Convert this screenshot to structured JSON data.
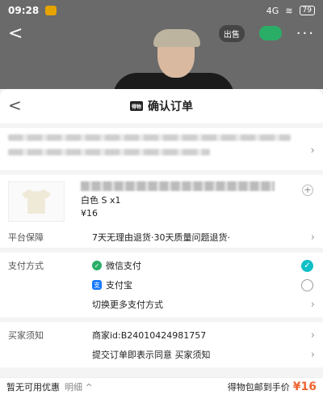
{
  "status_bar": {
    "time": "09:28",
    "signal": "4G",
    "battery": "79"
  },
  "bg_nav": {
    "back": "<",
    "sell_label": "出售",
    "more": "···"
  },
  "sheet": {
    "back": "<",
    "title": "确认订单",
    "title_logo": "得物"
  },
  "product": {
    "variant": "白色 S x1",
    "price": "¥16",
    "plus": "+"
  },
  "guarantee": {
    "label": "平台保障",
    "value": "7天无理由退货·30天质量问题退货·"
  },
  "payment": {
    "label": "支付方式",
    "options": [
      {
        "name": "微信支付",
        "icon": "wechat-pay-icon",
        "selected": true
      },
      {
        "name": "支付宝",
        "icon": "alipay-icon",
        "selected": false
      }
    ],
    "more": "切换更多支付方式"
  },
  "notice": {
    "label": "买家须知",
    "merchant_id": "商家id:B24010424981757",
    "agreement": "提交订单即表示同意 买家须知"
  },
  "bottom": {
    "coupon": "暂无可用优惠",
    "detail": "明细 ^",
    "summary": "得物包邮到手价",
    "price": "¥16"
  },
  "colors": {
    "accent": "#0fbfc6",
    "price": "#e63",
    "wechat": "#2aae67",
    "alipay": "#1677ff"
  }
}
